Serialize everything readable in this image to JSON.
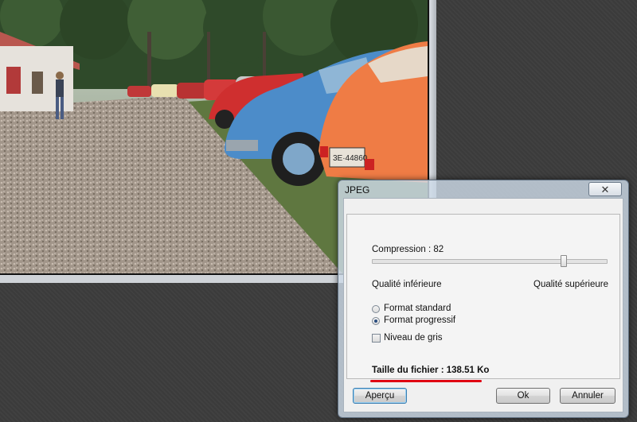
{
  "dialog": {
    "title": "JPEG",
    "close_icon": "close-icon",
    "close_glyph": "✕",
    "compression_label": "Compression : 82",
    "compression_value": 82,
    "compression_max": 100,
    "low_quality_label": "Qualité inférieure",
    "high_quality_label": "Qualité supérieure",
    "format_options": [
      {
        "label": "Format standard",
        "selected": false
      },
      {
        "label": "Format progressif",
        "selected": true
      }
    ],
    "grayscale_label": "Niveau de gris",
    "grayscale_checked": false,
    "file_size_label": "Taille du fichier : 138.51 Ko",
    "buttons": {
      "preview": "Aperçu",
      "ok": "Ok",
      "cancel": "Annuler"
    },
    "accent_color": "#e00012"
  },
  "photo": {
    "plate_text": "3E·44860",
    "description_icon": "photo-car-meet"
  }
}
